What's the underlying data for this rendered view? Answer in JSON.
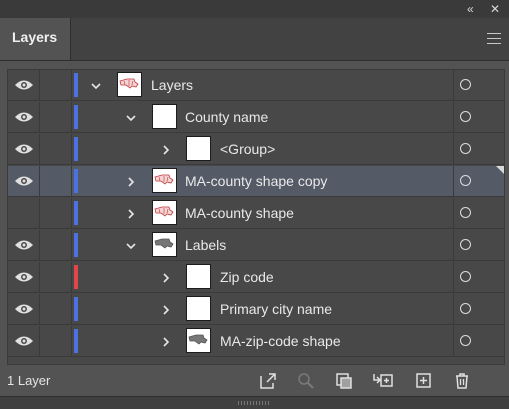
{
  "window": {
    "collapse_glyph": "«",
    "close_glyph": "✕"
  },
  "tabs": [
    {
      "label": "Layers"
    }
  ],
  "panel_menu_icon": "hamburger-menu-icon",
  "colors": {
    "blue": "#4a72e0",
    "red": "#e0464a",
    "selected_row": "#545a66",
    "panel_bg": "#484848"
  },
  "layers": [
    {
      "name": "Layers",
      "visible": true,
      "color": "blue",
      "expanded": true,
      "thumb": "map-thumb"
    },
    {
      "name": "County name",
      "visible": true,
      "color": "blue",
      "expanded": true,
      "thumb": "blank"
    },
    {
      "name": "<Group>",
      "visible": true,
      "color": "blue",
      "expanded": false,
      "thumb": "blank"
    },
    {
      "name": "MA-county shape copy",
      "visible": true,
      "color": "blue",
      "expanded": false,
      "thumb": "map-thumb",
      "selected": true
    },
    {
      "name": "MA-county shape",
      "visible": false,
      "color": "blue",
      "expanded": false,
      "thumb": "map-thumb"
    },
    {
      "name": "Labels",
      "visible": true,
      "color": "blue",
      "expanded": true,
      "thumb": "gray-map-thumb"
    },
    {
      "name": "Zip code",
      "visible": true,
      "color": "red",
      "expanded": false,
      "thumb": "blank"
    },
    {
      "name": "Primary city name",
      "visible": true,
      "color": "blue",
      "expanded": false,
      "thumb": "blank"
    },
    {
      "name": "MA-zip-code shape",
      "visible": true,
      "color": "blue",
      "expanded": false,
      "thumb": "gray-map-thumb"
    }
  ],
  "footer": {
    "layer_count": "1 Layer",
    "icons": [
      "export-icon",
      "locate-object-icon",
      "clipping-mask-icon",
      "new-sublayer-icon",
      "new-layer-icon",
      "delete-icon"
    ]
  }
}
